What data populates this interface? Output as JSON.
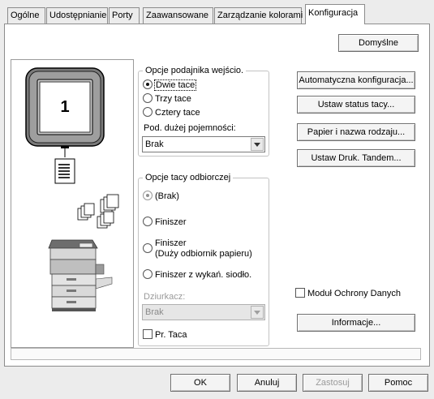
{
  "tabs": [
    {
      "label": "Ogólne",
      "active": false
    },
    {
      "label": "Udostępnianie",
      "active": false
    },
    {
      "label": "Porty",
      "active": false
    },
    {
      "label": "Zaawansowane",
      "active": false
    },
    {
      "label": "Zarządzanie kolorami",
      "active": false
    },
    {
      "label": "Konfiguracja",
      "active": true
    }
  ],
  "preview": {
    "tray_count": "1"
  },
  "buttons": {
    "default": "Domyślne",
    "auto_config": "Automatyczna konfiguracja...",
    "tray_status": "Ustaw status tacy...",
    "paper_name": "Papier i nazwa rodzaju...",
    "tandem": "Ustaw Druk. Tandem...",
    "info": "Informacje..."
  },
  "input_tray_group": {
    "title": "Opcje podajnika wejścio.",
    "options": [
      {
        "label": "Dwie tace",
        "selected": true
      },
      {
        "label": "Trzy tace",
        "selected": false
      },
      {
        "label": "Cztery tace",
        "selected": false
      }
    ],
    "hcf_label": "Pod. dużej pojemności:",
    "hcf_value": "Brak"
  },
  "output_tray_group": {
    "title": "Opcje tacy odbiorczej",
    "options": [
      {
        "label": "(Brak)",
        "selected": true
      },
      {
        "label": "Finiszer",
        "selected": false
      },
      {
        "label": "Finiszer",
        "sub": "(Duży odbiornik papieru)",
        "selected": false
      },
      {
        "label": "Finiszer z wykań. siodło.",
        "selected": false
      }
    ],
    "punch_label": "Dziurkacz:",
    "punch_value": "Brak",
    "pr_tray_label": "Pr. Taca"
  },
  "data_security_label": "Moduł Ochrony Danych",
  "footer": {
    "ok": "OK",
    "cancel": "Anuluj",
    "apply": "Zastosuj",
    "help": "Pomoc"
  },
  "colors": {
    "dialog_bg": "#ececec",
    "panel_bg": "#ffffff",
    "border": "#8c8c8c"
  }
}
